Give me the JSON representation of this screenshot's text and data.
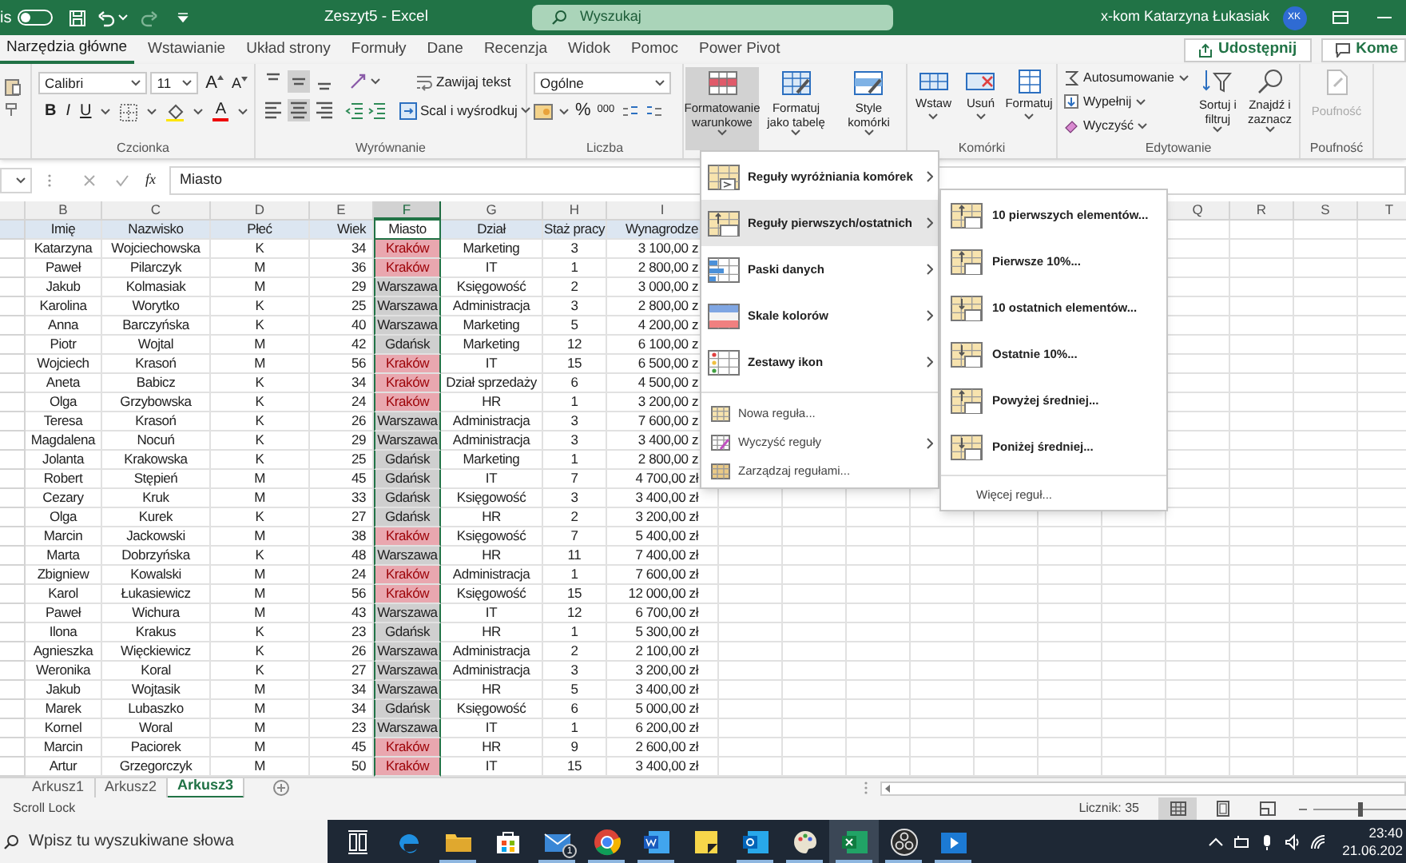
{
  "title_bar": {
    "autosave_label": "is",
    "autosave_on": false,
    "title": "Zeszyt5 - Excel",
    "search_placeholder": "Wyszukaj",
    "user_name": "x-kom Katarzyna Łukasiak",
    "user_initials": "XK"
  },
  "tabs": [
    {
      "label": "Narzędzia główne",
      "selected": true
    },
    {
      "label": "Wstawianie",
      "selected": false
    },
    {
      "label": "Układ strony",
      "selected": false
    },
    {
      "label": "Formuły",
      "selected": false
    },
    {
      "label": "Dane",
      "selected": false
    },
    {
      "label": "Recenzja",
      "selected": false
    },
    {
      "label": "Widok",
      "selected": false
    },
    {
      "label": "Pomoc",
      "selected": false
    },
    {
      "label": "Power Pivot",
      "selected": false
    }
  ],
  "share_button": "Udostępnij",
  "comments_button": "Kome",
  "ribbon": {
    "font": {
      "name": "Calibri",
      "size": "11"
    },
    "font_size_buttons": [
      "A",
      "A"
    ],
    "format_buttons": [
      "B",
      "I",
      "U"
    ],
    "font_color_button": "A",
    "font_group_label": "Czcionka",
    "vertical_alignment": [
      {
        "selected": false
      },
      {
        "selected": true
      },
      {
        "selected": false
      }
    ],
    "horizontal_alignment": [
      {
        "selected": false
      },
      {
        "selected": true
      },
      {
        "selected": false
      }
    ],
    "wrap_text": "Zawijaj tekst",
    "merge_center": "Scal i wyśrodkuj",
    "alignment_group_label": "Wyrównanie",
    "number_format": "Ogólne",
    "number_buttons": [
      "%",
      "000"
    ],
    "number_group_label": "Liczba",
    "style_buttons": [
      {
        "label": "Formatowanie warunkowe",
        "selected": true
      },
      {
        "label": "Formatuj jako tabelę",
        "selected": false
      },
      {
        "label": "Style komórki",
        "selected": false
      }
    ],
    "cells_buttons": [
      "Wstaw",
      "Usuń",
      "Formatuj"
    ],
    "cells_group_label": "Komórki",
    "editing_items": [
      "Autosumowanie",
      "Wypełnij",
      "Wyczyść"
    ],
    "editing_buttons": [
      "Sortuj i filtruj",
      "Znajdź i zaznacz"
    ],
    "editing_group_label": "Edytowanie",
    "sensitivity": {
      "label": "Poufność",
      "disabled": true
    },
    "sensitivity_group_label": "Poufność"
  },
  "formula_bar": {
    "function_label": "fx",
    "value": "Miasto"
  },
  "sheet": {
    "columns": [
      {
        "letter": "B",
        "selected": false
      },
      {
        "letter": "C",
        "selected": false
      },
      {
        "letter": "D",
        "selected": false
      },
      {
        "letter": "E",
        "selected": false
      },
      {
        "letter": "F",
        "selected": true
      },
      {
        "letter": "G",
        "selected": false
      },
      {
        "letter": "H",
        "selected": false
      },
      {
        "letter": "I",
        "selected": false
      }
    ],
    "right_columns": [
      "Q",
      "R",
      "S",
      "T"
    ],
    "header_row": [
      "Imię",
      "Nazwisko",
      "Płeć",
      "Wiek",
      "Miasto",
      "Dział",
      "Staż pracy",
      "Wynagrodze"
    ],
    "rows": [
      {
        "cells": [
          "Katarzyna",
          "Wojciechowska",
          "K",
          "34",
          "Kraków",
          "Marketing",
          "3",
          "3 100,00 z"
        ],
        "highlighted": true
      },
      {
        "cells": [
          "Paweł",
          "Pilarczyk",
          "M",
          "36",
          "Kraków",
          "IT",
          "1",
          "2 800,00 z"
        ],
        "highlighted": true
      },
      {
        "cells": [
          "Jakub",
          "Kolmasiak",
          "M",
          "29",
          "Warszawa",
          "Księgowość",
          "2",
          "3 000,00 z"
        ],
        "highlighted": false
      },
      {
        "cells": [
          "Karolina",
          "Worytko",
          "K",
          "25",
          "Warszawa",
          "Administracja",
          "3",
          "2 800,00 z"
        ],
        "highlighted": false
      },
      {
        "cells": [
          "Anna",
          "Barczyńska",
          "K",
          "40",
          "Warszawa",
          "Marketing",
          "5",
          "4 200,00 z"
        ],
        "highlighted": false
      },
      {
        "cells": [
          "Piotr",
          "Wojtal",
          "M",
          "42",
          "Gdańsk",
          "Marketing",
          "12",
          "6 100,00 z"
        ],
        "highlighted": false
      },
      {
        "cells": [
          "Wojciech",
          "Krasoń",
          "M",
          "56",
          "Kraków",
          "IT",
          "15",
          "6 500,00 z"
        ],
        "highlighted": true
      },
      {
        "cells": [
          "Aneta",
          "Babicz",
          "K",
          "34",
          "Kraków",
          "Dział sprzedaży",
          "6",
          "4 500,00 z"
        ],
        "highlighted": true
      },
      {
        "cells": [
          "Olga",
          "Grzybowska",
          "K",
          "24",
          "Kraków",
          "HR",
          "1",
          "3 200,00 z"
        ],
        "highlighted": true
      },
      {
        "cells": [
          "Teresa",
          "Krasoń",
          "K",
          "26",
          "Warszawa",
          "Administracja",
          "3",
          "7 600,00 z"
        ],
        "highlighted": false
      },
      {
        "cells": [
          "Magdalena",
          "Nocuń",
          "K",
          "29",
          "Warszawa",
          "Administracja",
          "3",
          "3 400,00 z"
        ],
        "highlighted": false
      },
      {
        "cells": [
          "Jolanta",
          "Krakowska",
          "K",
          "25",
          "Gdańsk",
          "Marketing",
          "1",
          "2 800,00 z"
        ],
        "highlighted": false
      },
      {
        "cells": [
          "Robert",
          "Stępień",
          "M",
          "45",
          "Gdańsk",
          "IT",
          "7",
          "4 700,00 zł"
        ],
        "highlighted": false
      },
      {
        "cells": [
          "Cezary",
          "Kruk",
          "M",
          "33",
          "Gdańsk",
          "Księgowość",
          "3",
          "3 400,00 zł"
        ],
        "highlighted": false
      },
      {
        "cells": [
          "Olga",
          "Kurek",
          "K",
          "27",
          "Gdańsk",
          "HR",
          "2",
          "3 200,00 zł"
        ],
        "highlighted": false
      },
      {
        "cells": [
          "Marcin",
          "Jackowski",
          "M",
          "38",
          "Kraków",
          "Księgowość",
          "7",
          "5 400,00 zł"
        ],
        "highlighted": true
      },
      {
        "cells": [
          "Marta",
          "Dobrzyńska",
          "K",
          "48",
          "Warszawa",
          "HR",
          "11",
          "7 400,00 zł"
        ],
        "highlighted": false
      },
      {
        "cells": [
          "Zbigniew",
          "Kowalski",
          "M",
          "24",
          "Kraków",
          "Administracja",
          "1",
          "7 600,00 zł"
        ],
        "highlighted": true
      },
      {
        "cells": [
          "Karol",
          "Łukasiewicz",
          "M",
          "56",
          "Kraków",
          "Księgowość",
          "15",
          "12 000,00 zł"
        ],
        "highlighted": true
      },
      {
        "cells": [
          "Paweł",
          "Wichura",
          "M",
          "43",
          "Warszawa",
          "IT",
          "12",
          "6 700,00 zł"
        ],
        "highlighted": false
      },
      {
        "cells": [
          "Ilona",
          "Krakus",
          "K",
          "23",
          "Gdańsk",
          "HR",
          "1",
          "5 300,00 zł"
        ],
        "highlighted": false
      },
      {
        "cells": [
          "Agnieszka",
          "Więckiewicz",
          "K",
          "26",
          "Warszawa",
          "Administracja",
          "2",
          "2 100,00 zł"
        ],
        "highlighted": false
      },
      {
        "cells": [
          "Weronika",
          "Koral",
          "K",
          "27",
          "Warszawa",
          "Administracja",
          "3",
          "3 200,00 zł"
        ],
        "highlighted": false
      },
      {
        "cells": [
          "Jakub",
          "Wojtasik",
          "M",
          "34",
          "Warszawa",
          "HR",
          "5",
          "3 400,00 zł"
        ],
        "highlighted": false
      },
      {
        "cells": [
          "Marek",
          "Lubaszko",
          "M",
          "34",
          "Gdańsk",
          "Księgowość",
          "6",
          "5 000,00 zł"
        ],
        "highlighted": false
      },
      {
        "cells": [
          "Kornel",
          "Woral",
          "M",
          "23",
          "Warszawa",
          "IT",
          "1",
          "6 200,00 zł"
        ],
        "highlighted": false
      },
      {
        "cells": [
          "Marcin",
          "Paciorek",
          "M",
          "45",
          "Kraków",
          "HR",
          "9",
          "2 600,00 zł"
        ],
        "highlighted": true
      },
      {
        "cells": [
          "Artur",
          "Grzegorczyk",
          "M",
          "50",
          "Kraków",
          "IT",
          "15",
          "3 400,00 zł"
        ],
        "highlighted": true
      }
    ]
  },
  "conditional_menu": {
    "items": [
      {
        "label": "Reguły wyróżniania komórek",
        "kind": "large",
        "selected": false,
        "has_submenu": true
      },
      {
        "label": "Reguły pierwszych/ostatnich",
        "kind": "large",
        "selected": true,
        "has_submenu": true
      },
      {
        "label": "Paski danych",
        "kind": "large",
        "selected": false,
        "has_submenu": true
      },
      {
        "label": "Skale kolorów",
        "kind": "large",
        "selected": false,
        "has_submenu": true
      },
      {
        "label": "Zestawy ikon",
        "kind": "large",
        "selected": false,
        "has_submenu": true
      },
      {
        "label": "Nowa reguła...",
        "kind": "small",
        "selected": false,
        "has_submenu": false
      },
      {
        "label": "Wyczyść reguły",
        "kind": "small",
        "selected": false,
        "has_submenu": true
      },
      {
        "label": "Zarządzaj regułami...",
        "kind": "small",
        "selected": false,
        "has_submenu": false
      }
    ]
  },
  "submenu": {
    "items": [
      "10 pierwszych elementów...",
      "Pierwsze 10%...",
      "10 ostatnich elementów...",
      "Ostatnie 10%...",
      "Powyżej średniej...",
      "Poniżej średniej..."
    ],
    "more": "Więcej reguł..."
  },
  "sheet_tabs": [
    {
      "label": "Arkusz1",
      "selected": false
    },
    {
      "label": "Arkusz2",
      "selected": false
    },
    {
      "label": "Arkusz3",
      "selected": true
    }
  ],
  "status_bar": {
    "mode": "Scroll Lock",
    "count": "Licznik: 35",
    "views": [
      {
        "selected": true
      },
      {
        "selected": false
      },
      {
        "selected": false
      }
    ],
    "zoom": {
      "level": 0.5
    }
  },
  "taskbar": {
    "search_placeholder": "Wpisz tu wyszukiwane słowa",
    "mail_badge": "1",
    "apps": [
      {
        "kind": "taskview",
        "running": false,
        "selected": false
      },
      {
        "kind": "edge",
        "running": false,
        "selected": false
      },
      {
        "kind": "explorer",
        "running": true,
        "selected": false
      },
      {
        "kind": "store",
        "running": false,
        "selected": false
      },
      {
        "kind": "mail",
        "running": true,
        "selected": false
      },
      {
        "kind": "chrome",
        "running": true,
        "selected": false
      },
      {
        "kind": "word",
        "running": true,
        "selected": false
      },
      {
        "kind": "sticky",
        "running": false,
        "selected": false
      },
      {
        "kind": "outlook",
        "running": true,
        "selected": false
      },
      {
        "kind": "paint",
        "running": true,
        "selected": false
      },
      {
        "kind": "excel",
        "running": true,
        "selected": true
      },
      {
        "kind": "obs",
        "running": true,
        "selected": false
      },
      {
        "kind": "video",
        "running": true,
        "selected": false
      }
    ],
    "time": "23:40",
    "date": "21.06.202"
  }
}
